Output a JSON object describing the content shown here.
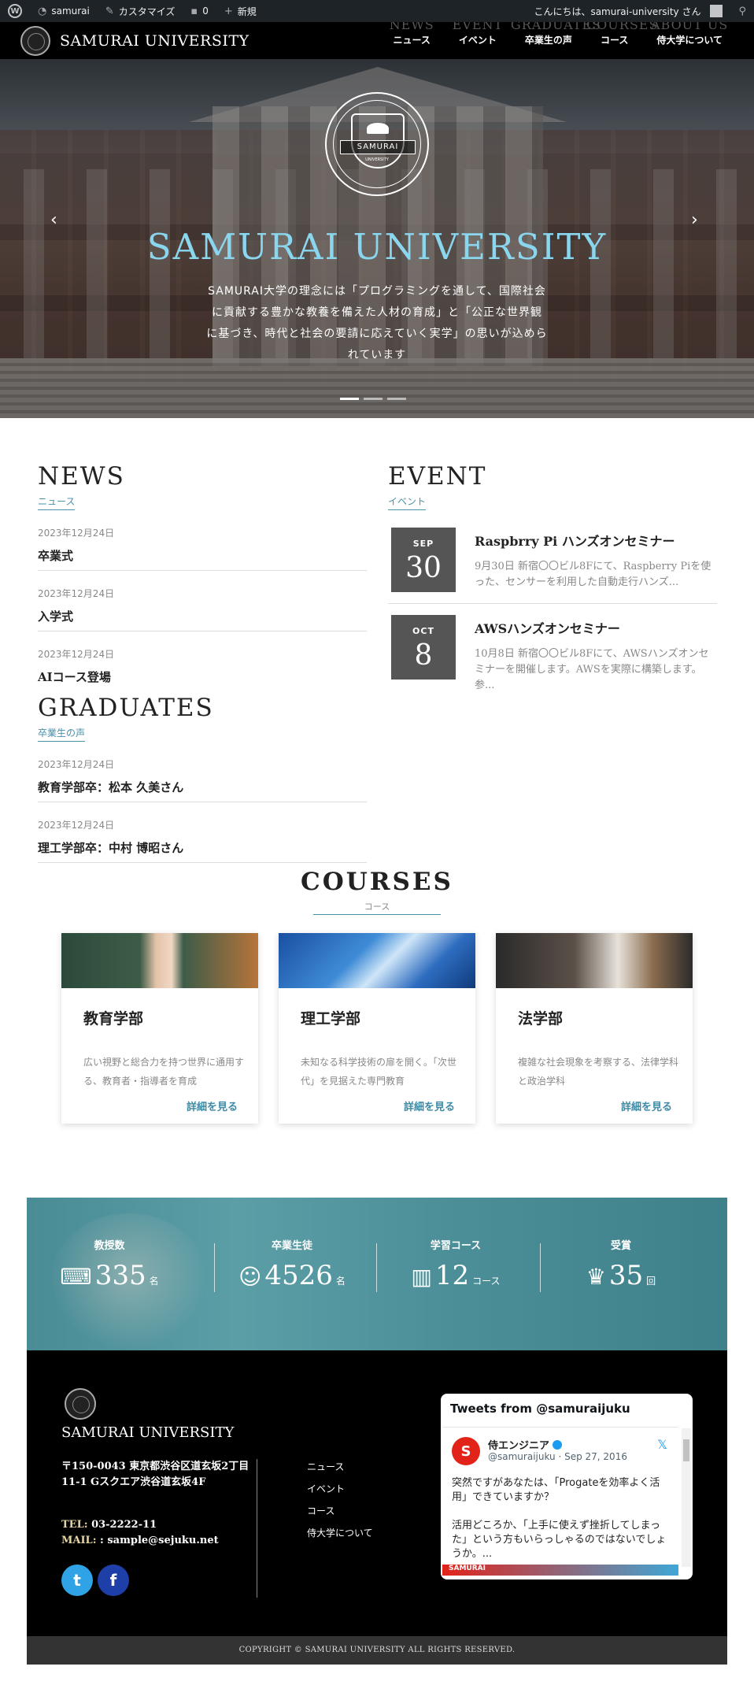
{
  "admin_bar": {
    "site_name": "samurai",
    "customize": "カスタマイズ",
    "comments_count": "0",
    "new": "新規",
    "greeting": "こんにちは、samurai-university さん"
  },
  "header": {
    "brand": "SAMURAI UNIVERSITY",
    "nav": [
      {
        "en": "NEWS",
        "ja": "ニュース"
      },
      {
        "en": "EVENT",
        "ja": "イベント"
      },
      {
        "en": "GRADUATES",
        "ja": "卒業生の声"
      },
      {
        "en": "COURSES",
        "ja": "コース"
      },
      {
        "en": "ABOUT US",
        "ja": "侍大学について"
      }
    ]
  },
  "hero": {
    "emblem_text": "SAMURAI",
    "emblem_sub": "UNIVERSITY",
    "title": "SAMURAI UNIVERSITY",
    "lead": "SAMURAI大学の理念には「プログラミングを通して、国際社会に貢献する豊かな教養を備えた人材の育成」と「公正な世界観に基づき、時代と社会の要請に応えていく実学」の思いが込められています",
    "prev": "‹",
    "next": "›"
  },
  "news": {
    "title": "NEWS",
    "subtitle": "ニュース",
    "items": [
      {
        "date": "2023年12月24日",
        "title": "卒業式"
      },
      {
        "date": "2023年12月24日",
        "title": "入学式"
      },
      {
        "date": "2023年12月24日",
        "title": "AIコース登場"
      }
    ]
  },
  "graduates": {
    "title": "GRADUATES",
    "subtitle": "卒業生の声",
    "items": [
      {
        "date": "2023年12月24日",
        "title": "教育学部卒：松本 久美さん"
      },
      {
        "date": "2023年12月24日",
        "title": "理工学部卒：中村 博昭さん"
      }
    ]
  },
  "event": {
    "title": "EVENT",
    "subtitle": "イベント",
    "items": [
      {
        "month": "SEP",
        "day": "30",
        "title": "Raspbrry Pi ハンズオンセミナー",
        "desc": "9月30日 新宿〇〇ビル8Fにて、Raspberry Piを使った、センサーを利用した自動走行ハンズ..."
      },
      {
        "month": "OCT",
        "day": "8",
        "title": "AWSハンズオンセミナー",
        "desc": "10月8日 新宿〇〇ビル8Fにて、AWSハンズオンセミナーを開催します。AWSを実際に構築します。参..."
      }
    ]
  },
  "courses": {
    "title": "COURSES",
    "subtitle": "コース",
    "more": "詳細を見る",
    "items": [
      {
        "title": "教育学部",
        "desc": "広い視野と総合力を持つ世界に通用する、教育者・指導者を育成"
      },
      {
        "title": "理工学部",
        "desc": "未知なる科学技術の扉を開く。「次世代」を見据えた専門教育"
      },
      {
        "title": "法学部",
        "desc": "複雑な社会現象を考察する、法律学科と政治学科"
      }
    ]
  },
  "stats": [
    {
      "label": "教授数",
      "icon": "teacher-board-icon",
      "glyph": "⌨",
      "value": "335",
      "unit": "名"
    },
    {
      "label": "卒業生徒",
      "icon": "graduate-book-icon",
      "glyph": "☺",
      "value": "4526",
      "unit": "名"
    },
    {
      "label": "学習コース",
      "icon": "books-icon",
      "glyph": "▥",
      "value": "12",
      "unit": "コース"
    },
    {
      "label": "受賞",
      "icon": "trophy-icon",
      "glyph": "♛",
      "value": "35",
      "unit": "回"
    }
  ],
  "footer": {
    "name": "SAMURAI UNIVERSITY",
    "address": "〒150-0043 東京都渋谷区道玄坂2丁目11-1 Gスクエア渋谷道玄坂4F",
    "tel_label": "TEL:",
    "tel": "03-2222-11",
    "mail_label": "MAIL:",
    "mail": ": sample@sejuku.net",
    "nav": [
      "ニュース",
      "イベント",
      "コース",
      "侍大学について"
    ],
    "tweets_title": "Tweets from @samuraijuku",
    "tweet": {
      "name": "侍エンジニア",
      "handle": "@samuraijuku · Sep 27, 2016",
      "text": "突然ですがあなたは、「Progateを効率よく活用」できていますか？\n\n活用どころか、「上手に使えず挫折してしまった」という方もいらっしゃるのではないでしょうか。...",
      "banner": "SAMURAI"
    },
    "copyright": "COPYRIGHT © SAMURAI UNIVERSITY ALL RIGHTS RESERVED."
  }
}
